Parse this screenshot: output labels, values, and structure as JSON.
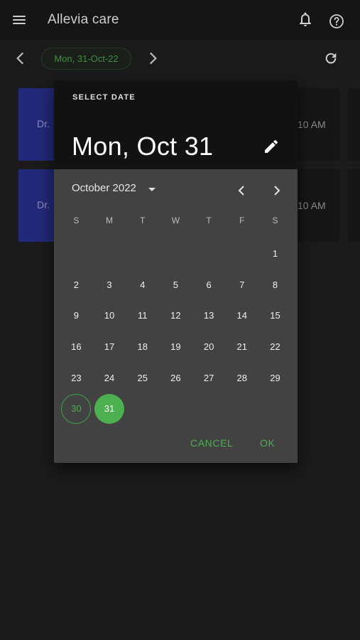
{
  "appbar": {
    "title": "Allevia care"
  },
  "strip": {
    "date_label": "Mon, 31-Oct-22"
  },
  "cards": [
    {
      "doctor_prefix": "Dr.",
      "time": "10 AM"
    },
    {
      "doctor_prefix": "Dr.",
      "time": "10 AM"
    }
  ],
  "dialog": {
    "heading": "SELECT DATE",
    "selected_display": "Mon, Oct 31",
    "month_label": "October 2022",
    "weekdays": [
      "S",
      "M",
      "T",
      "W",
      "T",
      "F",
      "S"
    ],
    "weeks": [
      [
        "",
        "",
        "",
        "",
        "",
        "",
        "1"
      ],
      [
        "2",
        "3",
        "4",
        "5",
        "6",
        "7",
        "8"
      ],
      [
        "9",
        "10",
        "11",
        "12",
        "13",
        "14",
        "15"
      ],
      [
        "16",
        "17",
        "18",
        "19",
        "20",
        "21",
        "22"
      ],
      [
        "23",
        "24",
        "25",
        "26",
        "27",
        "28",
        "29"
      ],
      [
        "30",
        "31",
        "",
        "",
        "",
        "",
        ""
      ]
    ],
    "today_day": "30",
    "selected_day": "31",
    "cancel_label": "CANCEL",
    "ok_label": "OK"
  },
  "colors": {
    "accent": "#4caf50",
    "doctor_chip": "#23297a",
    "dialog_bg": "#424242",
    "header_bg": "#121212"
  },
  "icons": [
    "menu-icon",
    "bell-icon",
    "help-icon",
    "chevron-left-icon",
    "chevron-right-icon",
    "refresh-icon",
    "pencil-icon",
    "dropdown-caret-icon"
  ]
}
